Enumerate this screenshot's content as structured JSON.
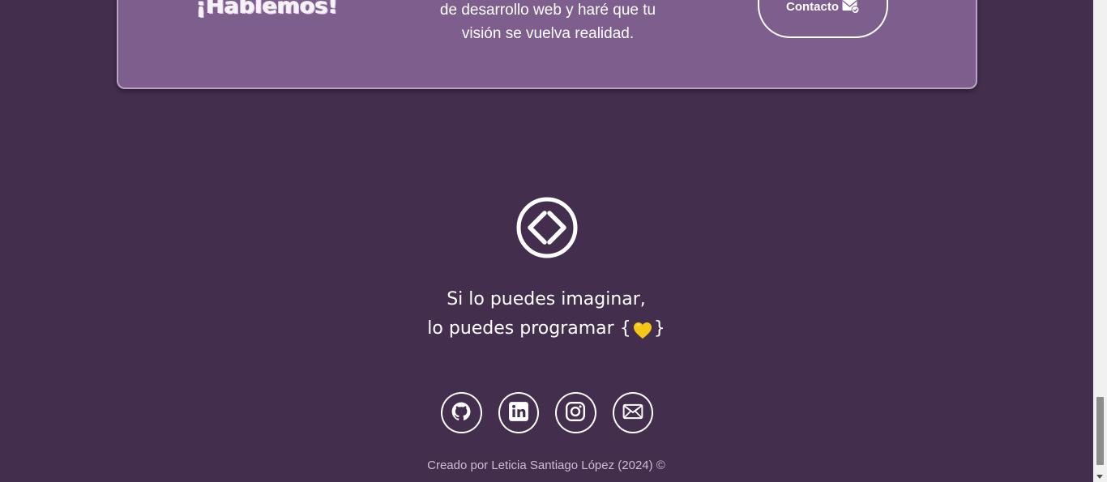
{
  "cta": {
    "heading": "¡Hablemos!",
    "text_line1": "de desarrollo web y haré que tu",
    "text_line2": "visión se vuelva realidad.",
    "button_label": "Contacto",
    "button_icon": "envelope-check-icon"
  },
  "footer": {
    "logo_icon": "code-diamond-icon",
    "motto_line1": "Si lo puedes imaginar,",
    "motto_line2": "lo puedes programar",
    "brace_open": "{",
    "brace_close": "}",
    "heart_icon": "yellow-heart-icon",
    "socials": [
      {
        "icon": "github-icon"
      },
      {
        "icon": "linkedin-icon"
      },
      {
        "icon": "instagram-icon"
      },
      {
        "icon": "envelope-icon"
      }
    ],
    "credit": "Creado por Leticia Santiago López (2024) ©"
  },
  "colors": {
    "background": "#432e4e",
    "card": "#7e5e8d",
    "heart": "#f5c518",
    "text": "#ffffff"
  }
}
